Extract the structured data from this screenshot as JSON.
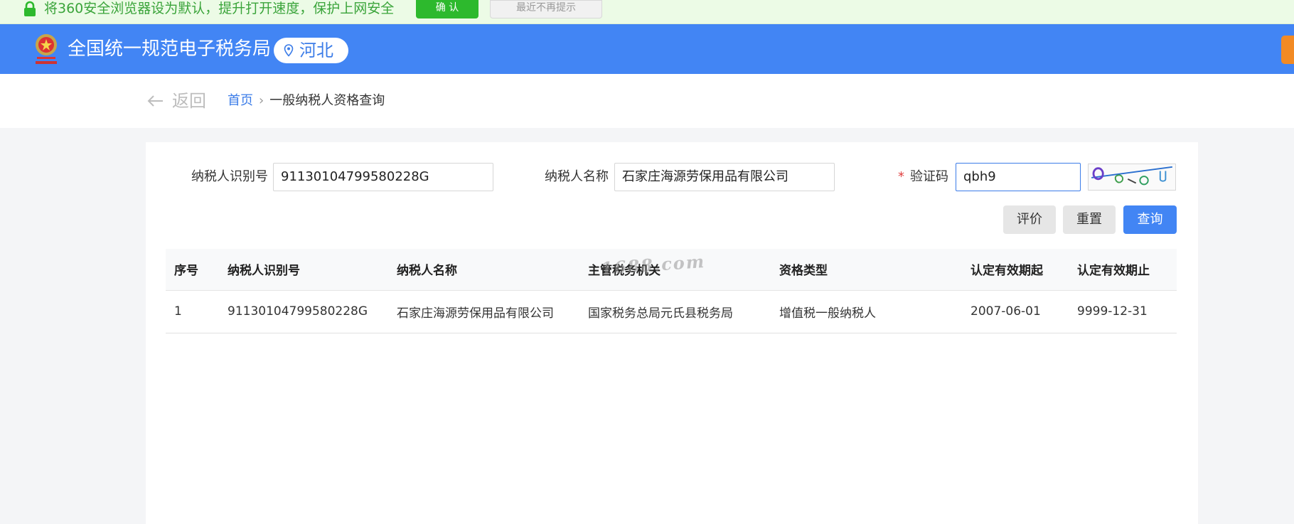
{
  "notice": {
    "message": "将360安全浏览器设为默认，提升打开速度，保护上网安全",
    "confirm_label": "确 认",
    "dismiss_label": "最近不再提示"
  },
  "header": {
    "site_title": "全国统一规范电子税务局",
    "region": "河北"
  },
  "breadcrumb": {
    "back_label": "返回",
    "home": "首页",
    "separator": "›",
    "current": "一般纳税人资格查询"
  },
  "form": {
    "taxpayer_id_label": "纳税人识别号",
    "taxpayer_id_value": "91130104799580228G",
    "taxpayer_name_label": "纳税人名称",
    "taxpayer_name_value": "石家庄海源劳保用品有限公司",
    "required_mark": "*",
    "captcha_label": "验证码",
    "captcha_value": "qbh9"
  },
  "buttons": {
    "evaluate": "评价",
    "reset": "重置",
    "query": "查询"
  },
  "table": {
    "headers": [
      "序号",
      "纳税人识别号",
      "纳税人名称",
      "主管税务机关",
      "资格类型",
      "认定有效期起",
      "认定有效期止"
    ],
    "rows": [
      [
        "1",
        "91130104799580228G",
        "石家庄海源劳保用品有限公司",
        "国家税务总局元氏县税务局",
        "增值税一般纳税人",
        "2007-06-01",
        "9999-12-31"
      ]
    ]
  },
  "watermark": "1688.com",
  "colors": {
    "header_blue": "#4285f4",
    "link_blue": "#3b7ce8",
    "notice_green": "#2db92d",
    "required_red": "#e04040"
  },
  "icons": [
    "lock-icon",
    "tax-emblem-icon",
    "location-pin-icon",
    "back-arrow-icon"
  ]
}
